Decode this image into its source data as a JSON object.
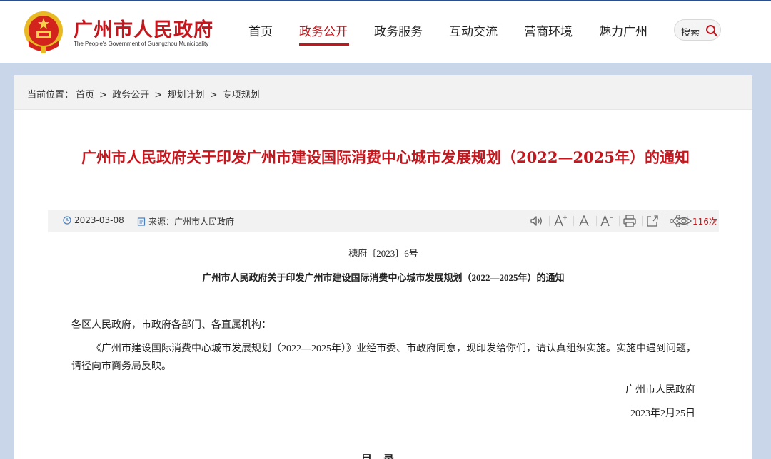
{
  "header": {
    "site_title": "广州市人民政府",
    "site_subtitle": "The People's Government of Guangzhou Municipality",
    "nav": [
      {
        "label": "首页"
      },
      {
        "label": "政务公开",
        "active": true
      },
      {
        "label": "政务服务"
      },
      {
        "label": "互动交流"
      },
      {
        "label": "营商环境"
      },
      {
        "label": "魅力广州"
      }
    ],
    "search_label": "搜索",
    "accent_color": "#c4161c"
  },
  "breadcrumb": {
    "prefix": "当前位置：",
    "items": [
      "首页",
      "政务公开",
      "规划计划",
      "专项规划"
    ],
    "separator": ">"
  },
  "article": {
    "title": "广州市人民政府关于印发广州市建设国际消费中心城市发展规划（2022—2025年）的通知",
    "meta": {
      "date": "2023-03-08",
      "source": "来源：广州市人民政府",
      "views": "116次",
      "tools": [
        "speaker-icon",
        "font-increase-icon",
        "font-reset-icon",
        "font-decrease-icon",
        "print-icon",
        "share-out-icon",
        "share-icon",
        "eye-icon"
      ]
    },
    "doc_number": "穗府〔2023〕6号",
    "subtitle": "广州市人民政府关于印发广州市建设国际消费中心城市发展规划（2022—2025年）的通知",
    "salutation": "各区人民政府，市政府各部门、各直属机构：",
    "body": "《广州市建设国际消费中心城市发展规划（2022—2025年）》业经市委、市政府同意，现印发给你们，请认真组织实施。实施中遇到问题，请径向市商务局反映。",
    "sign_org": "广州市人民政府",
    "sign_date": "2023年2月25日",
    "toc_heading": "目录"
  }
}
